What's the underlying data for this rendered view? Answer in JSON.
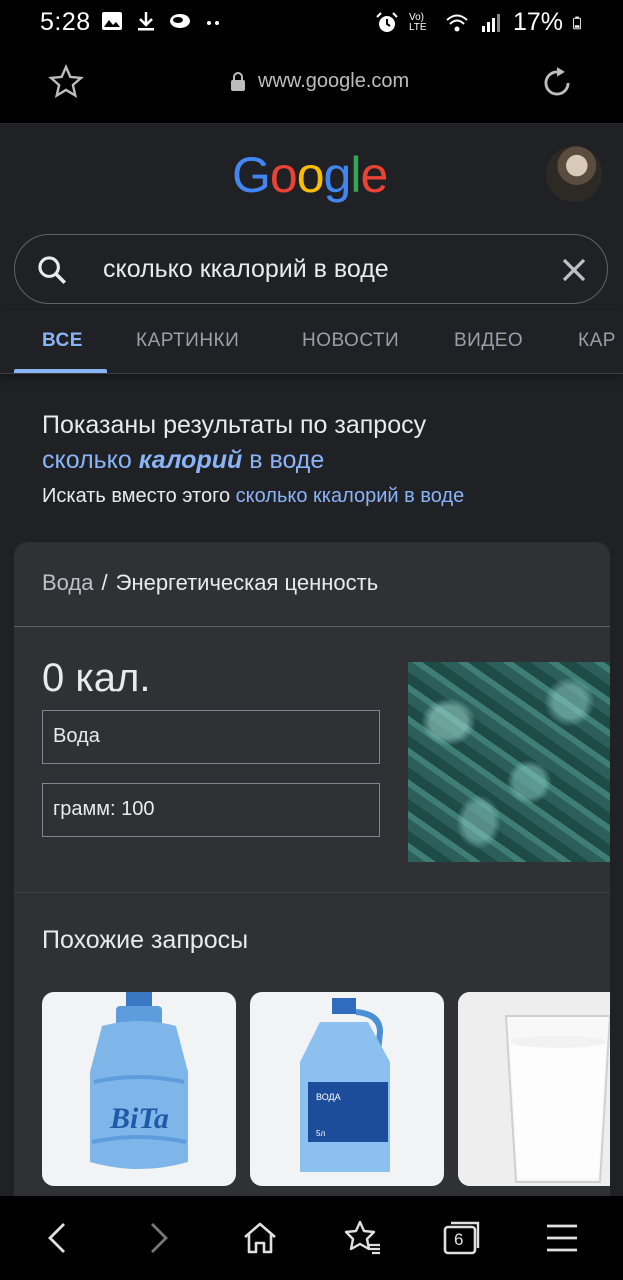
{
  "status_bar": {
    "time": "5:28",
    "battery": "17%",
    "network_label": "Vo) LTE"
  },
  "address_bar": {
    "url": "www.google.com"
  },
  "google_logo": {
    "letters": [
      "G",
      "o",
      "o",
      "g",
      "l",
      "e"
    ],
    "colors": [
      "#4285F4",
      "#EA4335",
      "#FBBC05",
      "#4285F4",
      "#34A853",
      "#EA4335"
    ]
  },
  "search": {
    "query": "сколько ккалорий в воде"
  },
  "tabs": [
    {
      "label": "ВСЕ",
      "active": true
    },
    {
      "label": "КАРТИНКИ",
      "active": false
    },
    {
      "label": "НОВОСТИ",
      "active": false
    },
    {
      "label": "ВИДЕО",
      "active": false
    },
    {
      "label": "КАР",
      "active": false
    }
  ],
  "correction": {
    "showing_prefix": "Показаны результаты по запросу",
    "corrected_part1": "сколько ",
    "corrected_bold": "калорий",
    "corrected_part2": " в воде",
    "instead_prefix": "Искать вместо этого ",
    "original_query": "сколько ккалорий в воде"
  },
  "card": {
    "breadcrumb_parent": "Вода",
    "breadcrumb_separator": "/",
    "breadcrumb_current": "Энергетическая ценность",
    "calories": "0 кал.",
    "food_field": "Вода",
    "amount_field": "грамм: 100",
    "related_title": "Похожие запросы",
    "bottle_brand": "BiTa",
    "bottle_label": "ВОДА",
    "bottle_volume": "5л"
  },
  "bottom_nav": {
    "tabs_count": "6"
  },
  "colors": {
    "accent": "#8ab4f8",
    "background": "#202124",
    "card": "#303134"
  }
}
